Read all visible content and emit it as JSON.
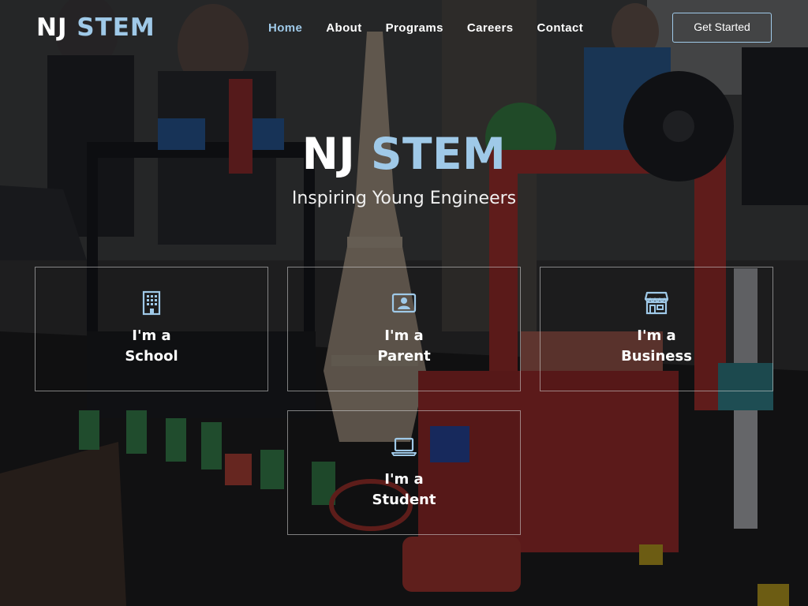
{
  "nav": {
    "brand_part1": "NJ",
    "brand_part2": "STEM",
    "links": [
      {
        "label": "Home",
        "active": true
      },
      {
        "label": "About",
        "active": false
      },
      {
        "label": "Programs",
        "active": false
      },
      {
        "label": "Careers",
        "active": false
      },
      {
        "label": "Contact",
        "active": false
      }
    ],
    "cta_label": "Get Started"
  },
  "hero": {
    "title_part1": "NJ",
    "title_part2": "STEM",
    "subtitle": "Inspiring Young Engineers"
  },
  "audiences": [
    {
      "line1": "I'm a",
      "line2": "School",
      "icon": "building-icon"
    },
    {
      "line1": "I'm a",
      "line2": "Parent",
      "icon": "id-card-icon"
    },
    {
      "line1": "I'm a",
      "line2": "Business",
      "icon": "store-icon"
    },
    {
      "line1": "I'm a",
      "line2": "Student",
      "icon": "laptop-icon"
    }
  ],
  "colors": {
    "accent": "#9fc9e8",
    "text": "#ffffff",
    "overlay": "#080a0e"
  }
}
